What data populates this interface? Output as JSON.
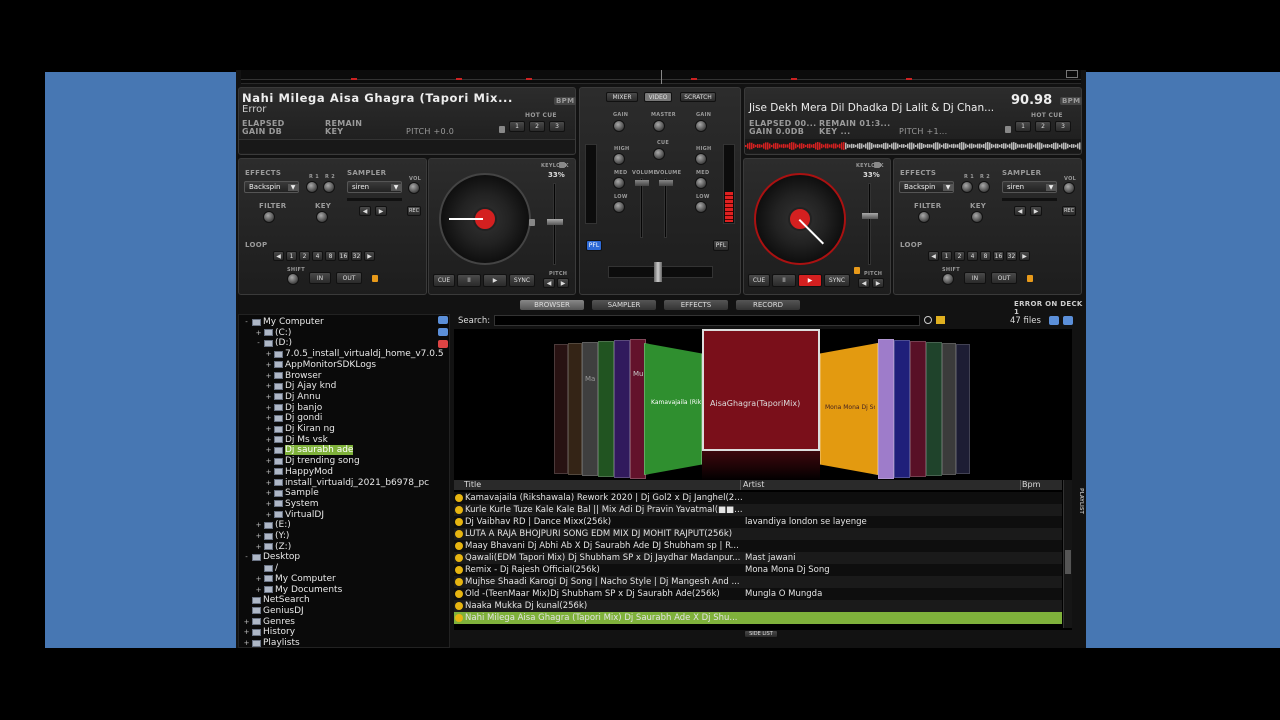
{
  "deck1": {
    "title": "Nahi Milega Aisa Ghagra (Tapori Mix...",
    "status": "Error",
    "bpm_label": "BPM",
    "elapsed_label": "ELAPSED",
    "remain_label": "REMAIN",
    "gain_label": "GAIN dB",
    "key_label": "KEY",
    "pitch": "PITCH +0.0",
    "hotcue_label": "HOT CUE",
    "hotcues": [
      "1",
      "2",
      "3"
    ],
    "effects_label": "EFFECTS",
    "effect_value": "Backspin",
    "r1": "R 1",
    "r2": "R 2",
    "sampler_label": "SAMPLER",
    "sampler_value": "siren",
    "vol_label": "VOL",
    "filter_label": "FILTER",
    "key_knob_label": "KEY",
    "rec_label": "REC",
    "loop_label": "LOOP",
    "loop_values": [
      "1",
      "2",
      "4",
      "8",
      "16",
      "32"
    ],
    "shift_label": "SHIFT",
    "in_label": "IN",
    "out_label": "OUT",
    "keylock_label": "KEYLOCK",
    "pitch_pct": "33%",
    "pitch_small": "PITCH",
    "cue_label": "CUE",
    "pause_label": "II",
    "play_label": "▶",
    "sync_label": "SYNC"
  },
  "deck2": {
    "title": "Jise Dekh Mera Dil Dhadka Dj Lalit & Dj Chan...",
    "bpm_value": "90.98",
    "bpm_label": "BPM",
    "elapsed": "ELAPSED 00...",
    "remain": "REMAIN 01:3...",
    "gain": "GAIN 0.0dB",
    "key": "KEY ...",
    "pitch": "PITCH +1...",
    "hotcue_label": "HOT CUE",
    "hotcues": [
      "1",
      "2",
      "3"
    ],
    "effects_label": "EFFECTS",
    "effect_value": "Backspin",
    "r1": "R 1",
    "r2": "R 2",
    "sampler_label": "SAMPLER",
    "sampler_value": "siren",
    "vol_label": "VOL",
    "filter_label": "FILTER",
    "key_knob_label": "KEY",
    "rec_label": "REC",
    "loop_label": "LOOP",
    "loop_values": [
      "1",
      "2",
      "4",
      "8",
      "16",
      "32"
    ],
    "shift_label": "SHIFT",
    "in_label": "IN",
    "out_label": "OUT",
    "keylock_label": "KEYLOCK",
    "pitch_pct": "33%",
    "pitch_small": "PITCH",
    "cue_label": "CUE",
    "pause_label": "II",
    "play_label": "▶",
    "sync_label": "SYNC"
  },
  "mixer": {
    "tabs": [
      "MIXER",
      "VIDEO",
      "SCRATCH"
    ],
    "gain": "GAIN",
    "master": "MASTER",
    "high": "HIGH",
    "cue": "CUE",
    "med": "MED",
    "low": "LOW",
    "volume": "VOLUME",
    "pfl": "PFL"
  },
  "tabs": [
    "BROWSER",
    "SAMPLER",
    "EFFECTS",
    "RECORD"
  ],
  "error_text": "ERROR ON DECK 1",
  "search_label": "Search:",
  "file_count": "47 files",
  "tree": [
    {
      "label": "My Computer",
      "level": 0,
      "exp": "-"
    },
    {
      "label": "(C:)",
      "level": 1,
      "exp": "+"
    },
    {
      "label": "(D:)",
      "level": 1,
      "exp": "-"
    },
    {
      "label": "7.0.5_install_virtualdj_home_v7.0.5",
      "level": 2,
      "exp": "+"
    },
    {
      "label": "AppMonitorSDKLogs",
      "level": 2,
      "exp": "+"
    },
    {
      "label": "Browser",
      "level": 2,
      "exp": "+"
    },
    {
      "label": "Dj  Ajay knd",
      "level": 2,
      "exp": "+"
    },
    {
      "label": "Dj  Annu",
      "level": 2,
      "exp": "+"
    },
    {
      "label": "Dj banjo",
      "level": 2,
      "exp": "+"
    },
    {
      "label": "Dj gondi",
      "level": 2,
      "exp": "+"
    },
    {
      "label": "Dj Kiran ng",
      "level": 2,
      "exp": "+"
    },
    {
      "label": "Dj Ms vsk",
      "level": 2,
      "exp": "+"
    },
    {
      "label": "Dj saurabh ade",
      "level": 2,
      "exp": "+",
      "selected": true
    },
    {
      "label": "Dj trending song",
      "level": 2,
      "exp": "+"
    },
    {
      "label": "HappyMod",
      "level": 2,
      "exp": "+"
    },
    {
      "label": "install_virtualdj_2021_b6978_pc",
      "level": 2,
      "exp": "+"
    },
    {
      "label": "Sample",
      "level": 2,
      "exp": "+"
    },
    {
      "label": "System",
      "level": 2,
      "exp": "+"
    },
    {
      "label": "VirtualDJ",
      "level": 2,
      "exp": "+"
    },
    {
      "label": "(E:)",
      "level": 1,
      "exp": "+"
    },
    {
      "label": "(Y:)",
      "level": 1,
      "exp": "+"
    },
    {
      "label": "(Z:)",
      "level": 1,
      "exp": "+"
    },
    {
      "label": "Desktop",
      "level": 0,
      "exp": "-"
    },
    {
      "label": "/",
      "level": 1,
      "exp": ""
    },
    {
      "label": "My Computer",
      "level": 1,
      "exp": "+"
    },
    {
      "label": "My Documents",
      "level": 1,
      "exp": "+"
    },
    {
      "label": "NetSearch",
      "level": 0,
      "exp": ""
    },
    {
      "label": "GeniusDJ",
      "level": 0,
      "exp": ""
    },
    {
      "label": "Genres",
      "level": 0,
      "exp": "+"
    },
    {
      "label": "History",
      "level": 0,
      "exp": "+"
    },
    {
      "label": "Playlists",
      "level": 0,
      "exp": "+"
    }
  ],
  "columns": {
    "title": "Title",
    "artist": "Artist",
    "bpm": "Bpm"
  },
  "tracks": [
    {
      "title": "Kamavajaila (Rikshawala) Rework 2020 | Dj Gol2 x Dj Janghel(25...",
      "artist": ""
    },
    {
      "title": "Kurle Kurle Tuze Kale Kale Bal || Mix Adi Dj Pravin Yavatmal(■■)(2...",
      "artist": ""
    },
    {
      "title": "Dj Vaibhav RD | Dance Mixx(256k)",
      "artist": "lavandiya london se layenge"
    },
    {
      "title": "LUTA A RAJA BHOJPURI SONG EDM MIX DJ MOHIT RAJPUT(256k)",
      "artist": ""
    },
    {
      "title": "Maay Bhavani Dj Abhi Ab X Dj Saurabh Ade DJ Shubham sp | R...",
      "artist": ""
    },
    {
      "title": "Qawali(EDM Tapori Mix) Dj Shubham SP x Dj Jaydhar Madanpur...",
      "artist": "Mast jawani"
    },
    {
      "title": "Remix - Dj Rajesh Official(256k)",
      "artist": "Mona Mona Dj Song"
    },
    {
      "title": "Mujhse Shaadi Karogi Dj Song | Nacho Style | Dj Mangesh And ...",
      "artist": ""
    },
    {
      "title": "Old -(TeenMaar Mix)Dj Shubham SP x Dj Saurabh Ade(256k)",
      "artist": "Mungla O Mungda"
    },
    {
      "title": "Naaka Mukka Dj kunal(256k)",
      "artist": ""
    },
    {
      "title": "Nahi Milega Aisa Ghagra (Tapori Mix) Dj Saurabh Ade X Dj Shu...",
      "artist": "",
      "selected": true
    }
  ],
  "side_list": "SIDE LIST",
  "playlist_vertical": "PLAYLIST",
  "covers": {
    "center_text": "AisaGhagra(TaporiMix)",
    "green_text": "Kamavajaila (Rikshawala) Rework",
    "orange_text": "Mona Mona Dj Song",
    "left_mini": "Ma",
    "left_mini2": "Mu"
  },
  "colors": {
    "accent": "#e02020",
    "selected_row": "#7fb13b",
    "background": "#4777b3"
  }
}
